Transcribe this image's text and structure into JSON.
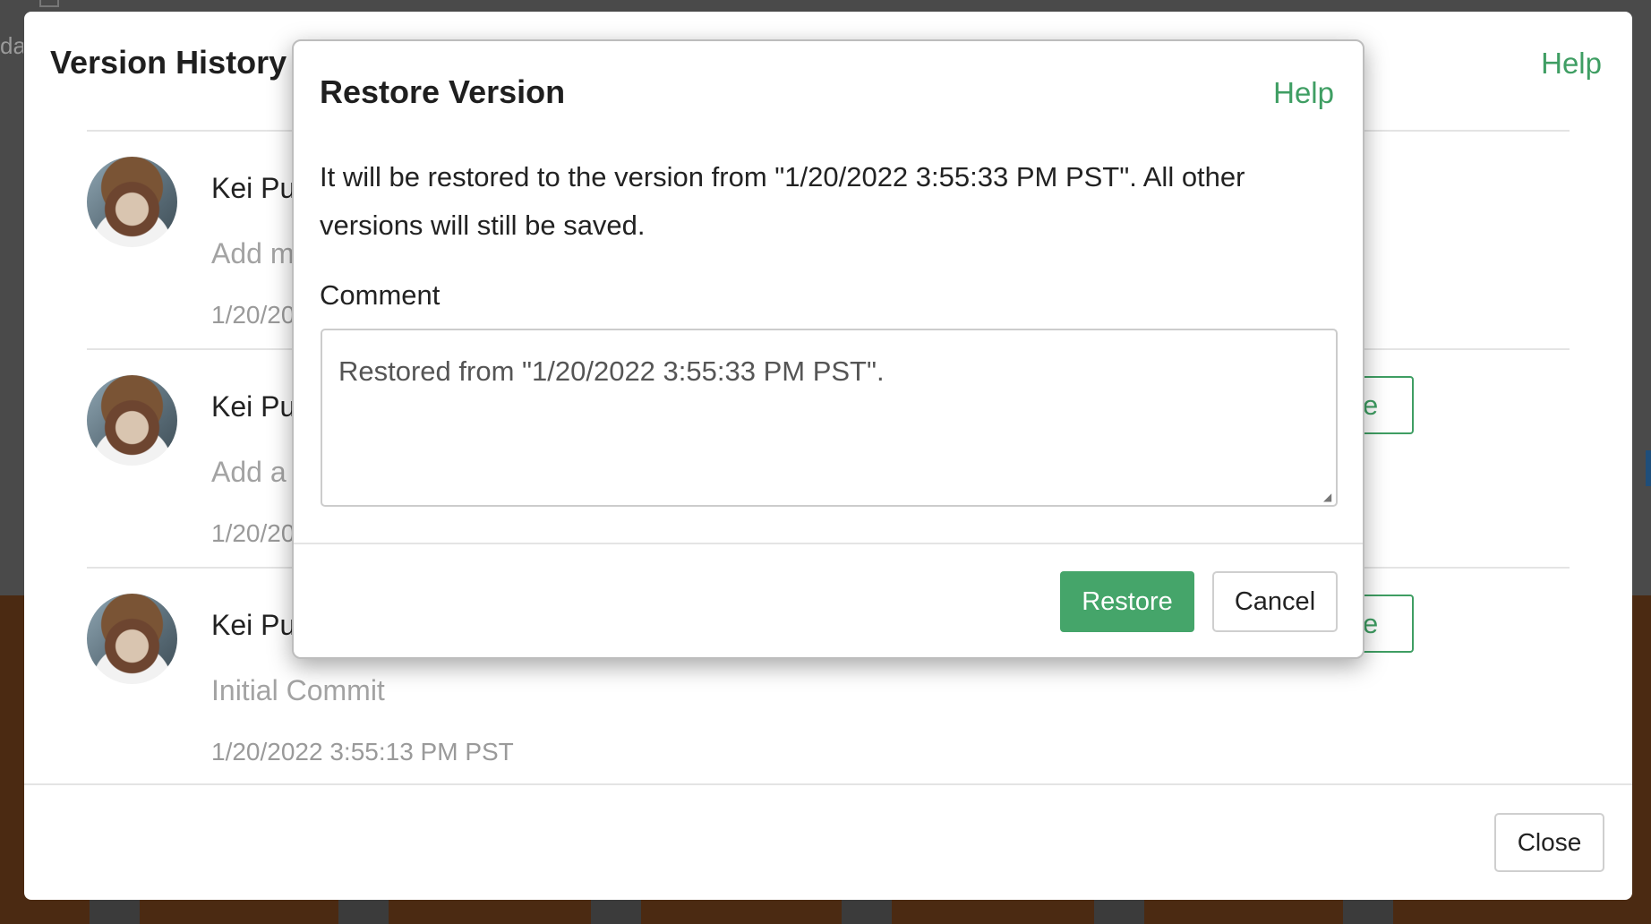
{
  "background": {
    "side_text": "da"
  },
  "version_history": {
    "title": "Version History",
    "help_label": "Help",
    "close_label": "Close",
    "entries": [
      {
        "author": "Kei Pu",
        "message": "Add m",
        "date": "1/20/20",
        "restore_label": ""
      },
      {
        "author": "Kei Pu",
        "message": "Add a",
        "date": "1/20/20",
        "restore_label": "Restore"
      },
      {
        "author": "Kei Pu",
        "message": "Initial Commit",
        "date": "1/20/2022 3:55:13 PM PST",
        "restore_label": "Restore"
      }
    ]
  },
  "restore_dialog": {
    "title": "Restore Version",
    "help_label": "Help",
    "description": "It will be restored to the version from \"1/20/2022 3:55:33 PM PST\". All other versions will still be saved.",
    "comment_label": "Comment",
    "comment_value": "Restored from \"1/20/2022 3:55:33 PM PST\".",
    "restore_label": "Restore",
    "cancel_label": "Cancel"
  },
  "colors": {
    "accent_green": "#3f9e63",
    "primary_button": "#45a56a"
  }
}
